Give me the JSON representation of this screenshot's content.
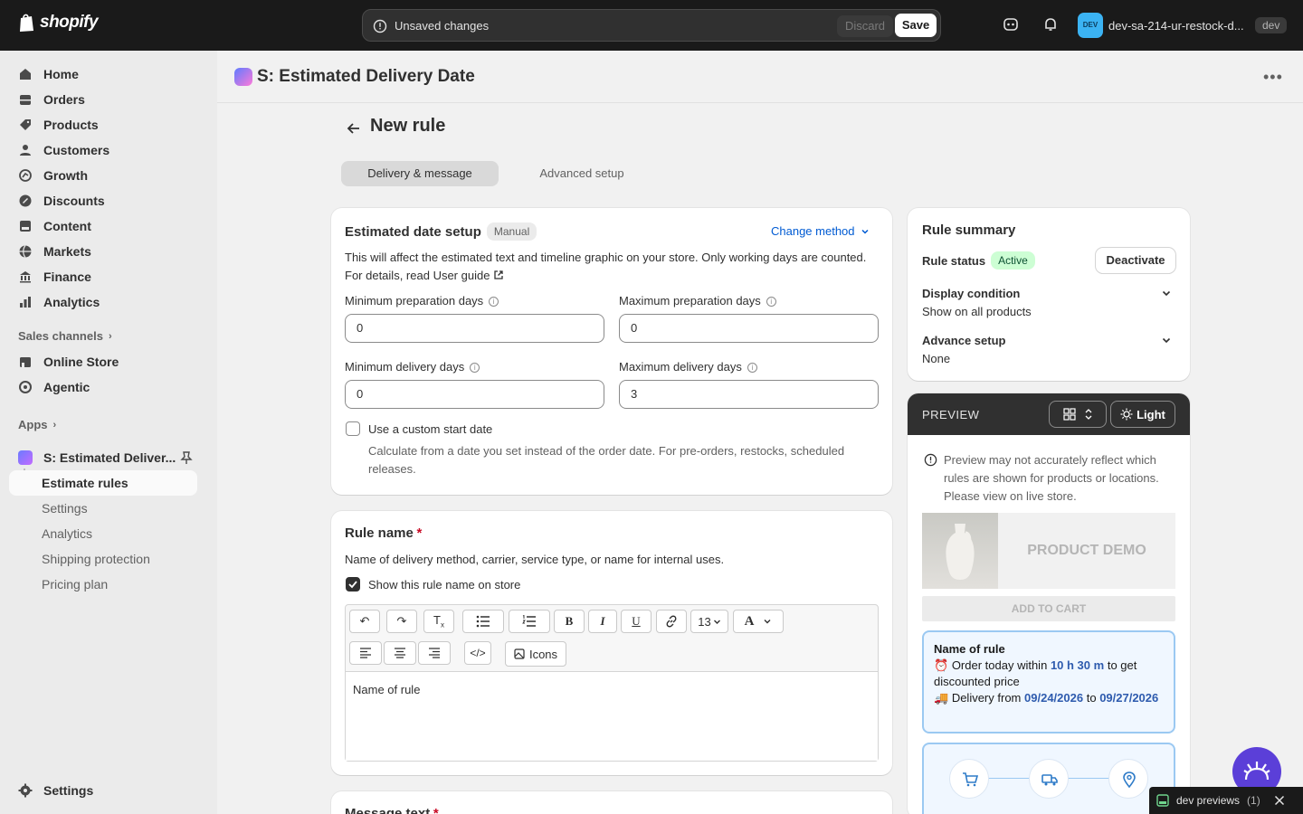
{
  "topbar": {
    "logo_text": "shopify",
    "unsaved_text": "Unsaved changes",
    "discard_label": "Discard",
    "save_label": "Save",
    "store_avatar": "DEV",
    "store_name": "dev-sa-214-ur-restock-d...",
    "store_tag": "dev"
  },
  "sidebar": {
    "items": [
      {
        "label": "Home",
        "icon": "home-icon"
      },
      {
        "label": "Orders",
        "icon": "orders-icon"
      },
      {
        "label": "Products",
        "icon": "tag-icon"
      },
      {
        "label": "Customers",
        "icon": "person-icon"
      },
      {
        "label": "Growth",
        "icon": "growth-icon"
      },
      {
        "label": "Discounts",
        "icon": "discount-icon"
      },
      {
        "label": "Content",
        "icon": "content-icon"
      },
      {
        "label": "Markets",
        "icon": "globe-icon"
      },
      {
        "label": "Finance",
        "icon": "bank-icon"
      },
      {
        "label": "Analytics",
        "icon": "chart-icon"
      }
    ],
    "sales_channels_label": "Sales channels",
    "channels": [
      {
        "label": "Online Store",
        "icon": "store-icon"
      },
      {
        "label": "Agentic",
        "icon": "agentic-icon"
      }
    ],
    "apps_label": "Apps",
    "app_name": "S: Estimated Deliver...",
    "app_subitems": [
      "Estimate rules",
      "Settings",
      "Analytics",
      "Shipping protection",
      "Pricing plan"
    ],
    "settings_label": "Settings"
  },
  "app": {
    "title": "S: Estimated Delivery Date",
    "page_title": "New rule",
    "tabs": [
      "Delivery & message",
      "Advanced setup"
    ]
  },
  "date_setup": {
    "title": "Estimated date setup",
    "badge": "Manual",
    "change_method": "Change method",
    "description": "This will affect the estimated text and timeline graphic on your store. Only working days are counted. For details, read",
    "guide_link": "User guide",
    "min_prep_label": "Minimum preparation days",
    "min_prep_value": "0",
    "max_prep_label": "Maximum preparation days",
    "max_prep_value": "0",
    "min_delivery_label": "Minimum delivery days",
    "min_delivery_value": "0",
    "max_delivery_label": "Maximum delivery days",
    "max_delivery_value": "3",
    "custom_start_label": "Use a custom start date",
    "custom_start_help": "Calculate from a date you set instead of the order date. For pre-orders, restocks, scheduled releases."
  },
  "rule_name": {
    "title": "Rule name",
    "required_mark": "*",
    "help": "Name of delivery method, carrier, service type, or name for internal uses.",
    "show_on_store_label": "Show this rule name on store",
    "font_size": "13",
    "icons_label": "Icons",
    "editor_value": "Name of rule"
  },
  "message_text": {
    "title": "Message text",
    "required_mark": "*"
  },
  "summary": {
    "title": "Rule summary",
    "status_label": "Rule status",
    "status_value": "Active",
    "deactivate_label": "Deactivate",
    "display_condition_label": "Display condition",
    "display_condition_value": "Show on all products",
    "advance_setup_label": "Advance setup",
    "advance_setup_value": "None"
  },
  "preview": {
    "title": "PREVIEW",
    "theme_label": "Light",
    "warning": "Preview may not accurately reflect which rules are shown for products or locations. Please view on live store.",
    "product_label": "PRODUCT DEMO",
    "add_to_cart": "ADD TO CART",
    "rule_name": "Name of rule",
    "line1_prefix": "Order today within",
    "line1_time": "10 h 30 m",
    "line1_suffix": "to get discounted price",
    "line2_prefix": "Delivery from",
    "date_from": "09/24/2026",
    "line2_mid": "to",
    "date_to": "09/27/2026",
    "emoji_clock": "⏰",
    "emoji_truck": "🚚"
  },
  "dev_previews": {
    "label": "dev previews",
    "count": "(1)"
  },
  "colors": {
    "accent": "#005bd3",
    "topbar": "#1a1a1a",
    "success_bg": "#cdfed4"
  }
}
